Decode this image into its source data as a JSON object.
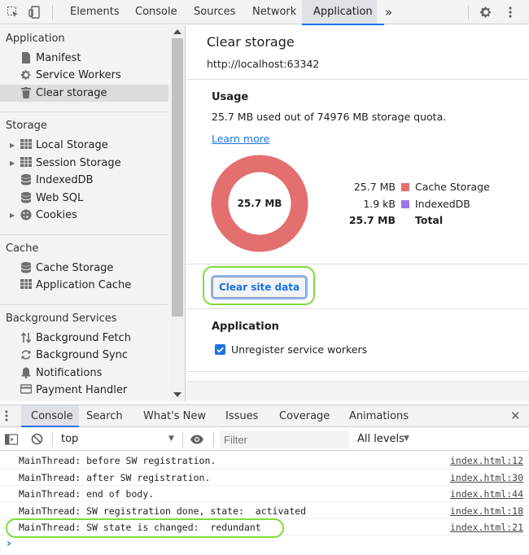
{
  "toolbar": {
    "tabs": [
      "Elements",
      "Console",
      "Sources",
      "Network",
      "Application"
    ],
    "active_tab": "Application",
    "more": "»"
  },
  "sidebar": {
    "sections": [
      {
        "title": "Application",
        "items": [
          {
            "label": "Manifest",
            "icon": "document-icon"
          },
          {
            "label": "Service Workers",
            "icon": "gear-icon"
          },
          {
            "label": "Clear storage",
            "icon": "trash-icon",
            "selected": true
          }
        ]
      },
      {
        "title": "Storage",
        "items": [
          {
            "label": "Local Storage",
            "icon": "grid-icon",
            "expandable": true
          },
          {
            "label": "Session Storage",
            "icon": "grid-icon",
            "expandable": true
          },
          {
            "label": "IndexedDB",
            "icon": "database-icon"
          },
          {
            "label": "Web SQL",
            "icon": "database-icon"
          },
          {
            "label": "Cookies",
            "icon": "cookie-icon",
            "expandable": true
          }
        ]
      },
      {
        "title": "Cache",
        "items": [
          {
            "label": "Cache Storage",
            "icon": "database-icon"
          },
          {
            "label": "Application Cache",
            "icon": "grid-icon"
          }
        ]
      },
      {
        "title": "Background Services",
        "items": [
          {
            "label": "Background Fetch",
            "icon": "updown-arrows-icon"
          },
          {
            "label": "Background Sync",
            "icon": "sync-icon"
          },
          {
            "label": "Notifications",
            "icon": "bell-icon"
          },
          {
            "label": "Payment Handler",
            "icon": "card-icon"
          }
        ]
      }
    ]
  },
  "main": {
    "title": "Clear storage",
    "origin": "http://localhost:63342",
    "usage": {
      "heading": "Usage",
      "summary": "25.7 MB used out of 74976 MB storage quota.",
      "learn_more": "Learn more",
      "donut_label": "25.7 MB",
      "donut_color": "#e46f6f",
      "rows": [
        {
          "size": "25.7 MB",
          "label": "Cache Storage",
          "color": "#e46f6f"
        },
        {
          "size": "1.9 kB",
          "label": "IndexedDB",
          "color": "#9c78e6"
        },
        {
          "size": "25.7 MB",
          "label": "Total",
          "bold": true
        }
      ]
    },
    "clear_button": "Clear site data",
    "application": {
      "heading": "Application",
      "checkbox_label": "Unregister service workers",
      "checked": true
    }
  },
  "drawer": {
    "tabs": [
      "Console",
      "Search",
      "What's New",
      "Issues",
      "Coverage",
      "Animations"
    ],
    "active_tab": "Console",
    "context": "top",
    "filter_placeholder": "Filter",
    "levels": "All levels",
    "logs": [
      {
        "msg": "MainThread: before SW registration.",
        "src": "index.html:12"
      },
      {
        "msg": "MainThread: after SW registration.",
        "src": "index.html:30"
      },
      {
        "msg": "MainThread: end of body.",
        "src": "index.html:44"
      },
      {
        "msg": "MainThread: SW registration done, state:  activated",
        "src": "index.html:18"
      },
      {
        "msg": "MainThread: SW state is changed:  redundant",
        "src": "index.html:21",
        "highlighted": true
      }
    ],
    "prompt": "›"
  },
  "colors": {
    "accent": "#1a73e8",
    "highlight_ring": "#7cdc39"
  }
}
